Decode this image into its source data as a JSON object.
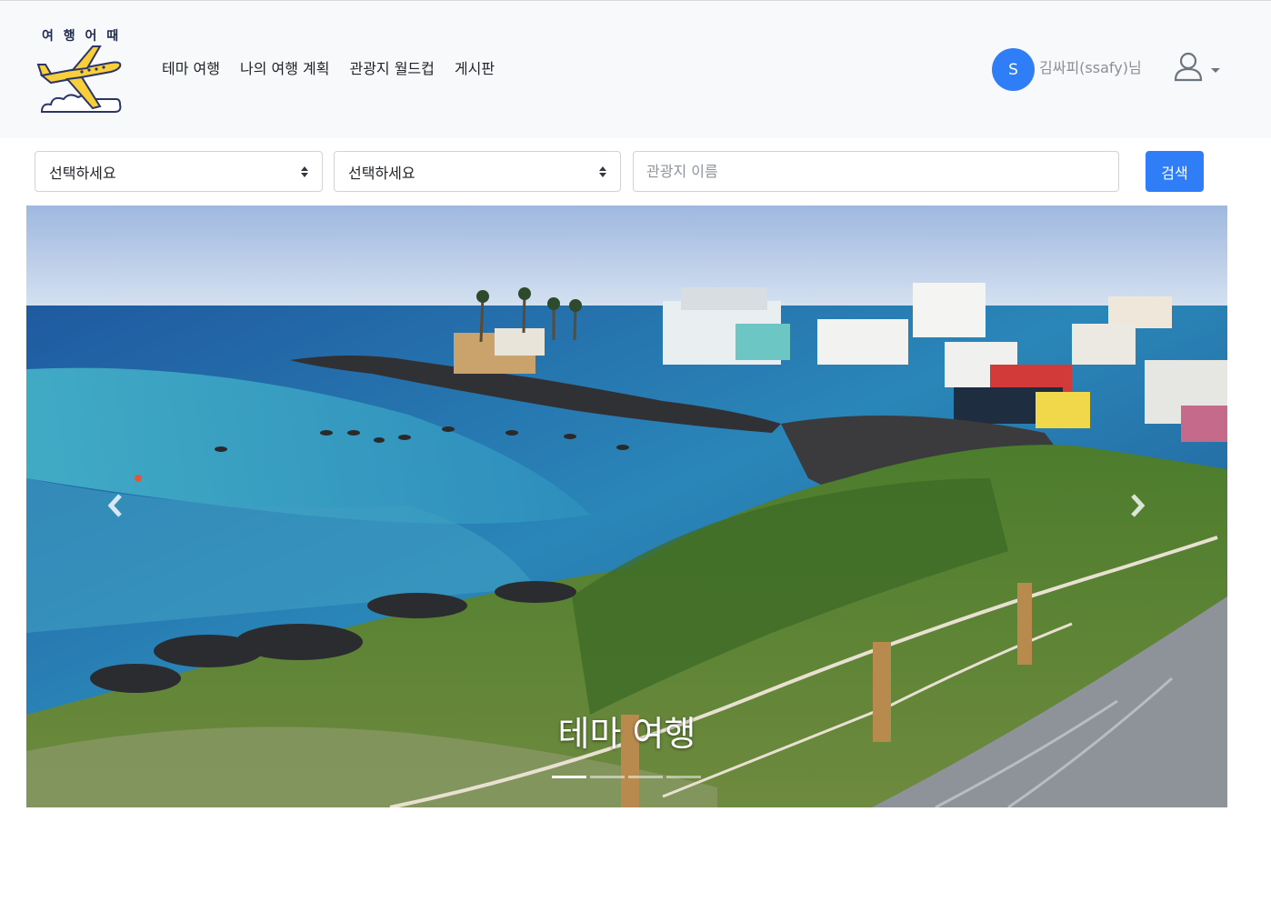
{
  "brand": {
    "logo_text": "여 행 어 때"
  },
  "nav": {
    "links": [
      "테마 여행",
      "나의 여행 계획",
      "관광지 월드컵",
      "게시판"
    ]
  },
  "user": {
    "avatar_initial": "S",
    "display_name": "김싸피(ssafy)님"
  },
  "search": {
    "select1_value": "선택하세요",
    "select2_value": "선택하세요",
    "name_placeholder": "관광지 이름",
    "button_label": "검색"
  },
  "carousel": {
    "caption": "테마 여행",
    "slide_count": 4,
    "active_index": 0
  },
  "colors": {
    "primary": "#2f7ef7",
    "navbar_bg": "#f8f9fa"
  }
}
